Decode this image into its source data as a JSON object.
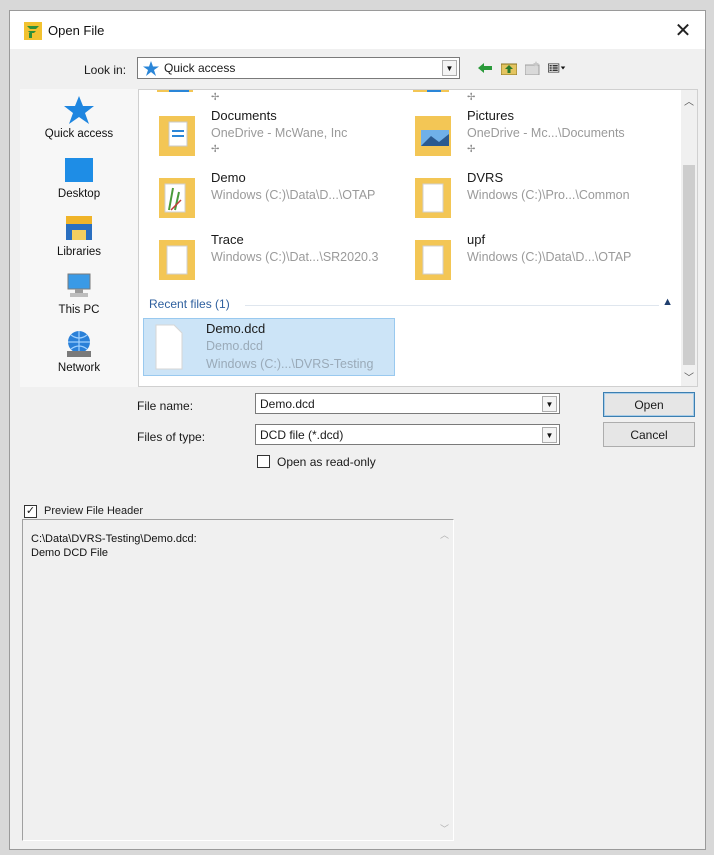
{
  "window": {
    "title": "Open File",
    "close_glyph": "✕"
  },
  "look_in": {
    "label": "Look in:",
    "value": "Quick access"
  },
  "places": [
    {
      "label": "Quick access",
      "icon": "quick-access-star-icon"
    },
    {
      "label": "Desktop",
      "icon": "desktop-icon"
    },
    {
      "label": "Libraries",
      "icon": "libraries-icon"
    },
    {
      "label": "This PC",
      "icon": "this-pc-icon"
    },
    {
      "label": "Network",
      "icon": "network-icon"
    }
  ],
  "folders": [
    {
      "name": "Documents",
      "path": "OneDrive - McWane, Inc",
      "pinned": true
    },
    {
      "name": "Pictures",
      "path": "OneDrive - Mc...\\Documents",
      "pinned": true
    },
    {
      "name": "Demo",
      "path": "Windows (C:)\\Data\\D...\\OTAP",
      "pinned": false
    },
    {
      "name": "DVRS",
      "path": "Windows (C:)\\Pro...\\Common",
      "pinned": false
    },
    {
      "name": "Trace",
      "path": "Windows (C:)\\Dat...\\SR2020.3",
      "pinned": false
    },
    {
      "name": "upf",
      "path": "Windows (C:)\\Data\\D...\\OTAP",
      "pinned": false
    }
  ],
  "recent": {
    "header": "Recent files (1)",
    "items": [
      {
        "name": "Demo.dcd",
        "line1": "Demo.dcd",
        "line2": "Windows (C:)...\\DVRS-Testing"
      }
    ]
  },
  "file_name": {
    "label": "File name:",
    "value": "Demo.dcd"
  },
  "file_type": {
    "label": "Files of type:",
    "value": "DCD file (*.dcd)"
  },
  "buttons": {
    "open": "Open",
    "cancel": "Cancel"
  },
  "read_only": {
    "label": "Open as read-only",
    "checked": false
  },
  "preview_header": {
    "label": "Preview File Header",
    "checked": true
  },
  "preview_text": "C:\\Data\\DVRS-Testing\\Demo.dcd:\nDemo DCD File",
  "colors": {
    "accent": "#2e5f9e",
    "selection": "#cce4f7",
    "folder": "#f3c655"
  }
}
